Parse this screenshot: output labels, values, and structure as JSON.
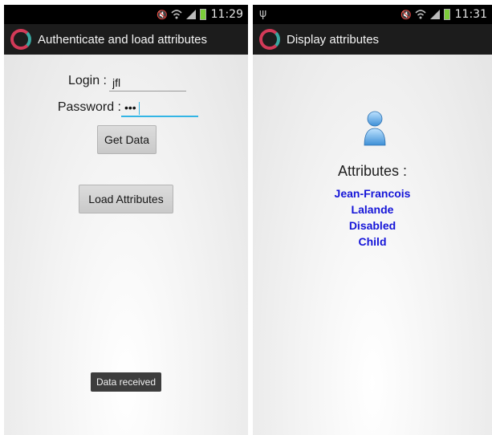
{
  "colors": {
    "action_bar": "#1c1c1c",
    "input_focus": "#33b5e5",
    "attribute_text": "#1515d8",
    "toast_bg": "#3d3d3d"
  },
  "left_screen": {
    "status_bar": {
      "time": "11:29"
    },
    "action_bar": {
      "icon": "app-logo-icon",
      "title": "Authenticate and load attributes"
    },
    "login": {
      "label": "Login :",
      "value": "jfl"
    },
    "password": {
      "label": "Password :",
      "value": "•••"
    },
    "get_data_button": "Get Data",
    "load_attributes_button": "Load Attributes",
    "toast": "Data received"
  },
  "right_screen": {
    "status_bar": {
      "time": "11:31",
      "usb_icon": "ψ"
    },
    "action_bar": {
      "icon": "app-logo-icon",
      "title": "Display attributes"
    },
    "user_icon": "user-icon",
    "attributes_heading": "Attributes :",
    "attributes": [
      "Jean-Francois",
      "Lalande",
      "Disabled",
      "Child"
    ]
  }
}
